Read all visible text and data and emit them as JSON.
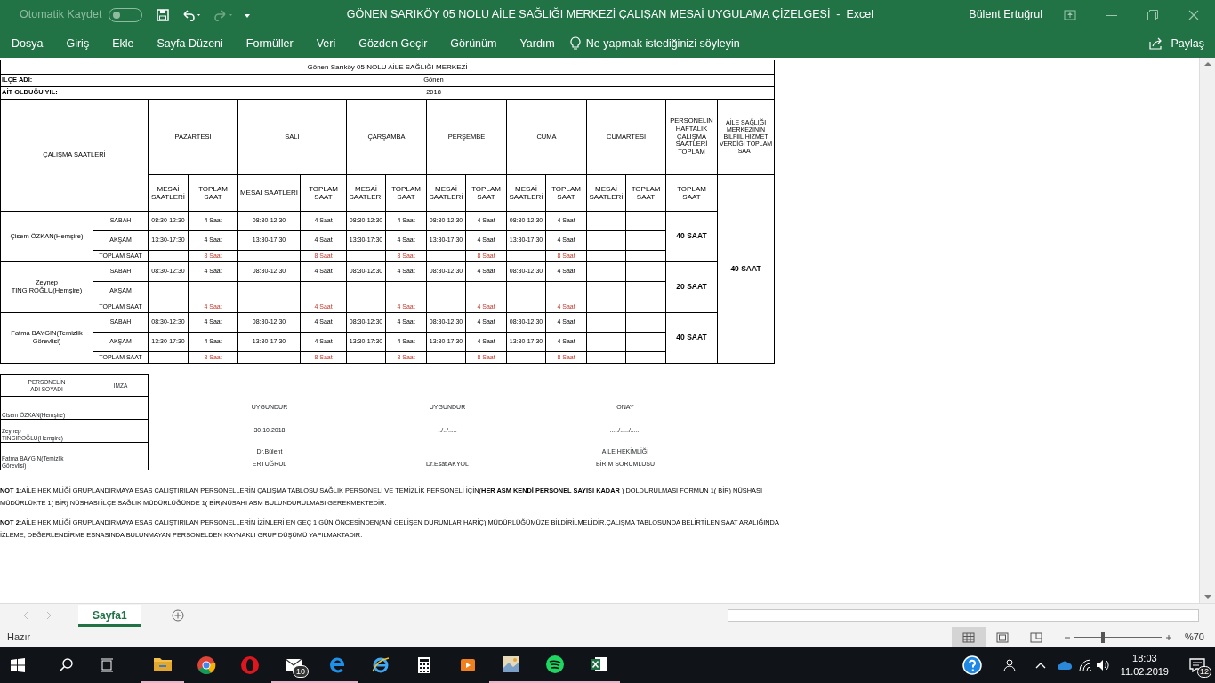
{
  "titlebar": {
    "autosave_label": "Otomatik Kaydet",
    "autosave_on": false,
    "title": "GÖNEN SARIKÖY 05 NOLU AİLE SAĞLIĞI MERKEZİ ÇALIŞAN MESAİ UYGULAMA ÇİZELGESİ  -  Excel",
    "user": "Bülent Ertuğrul"
  },
  "ribbon_tabs": [
    "Dosya",
    "Giriş",
    "Ekle",
    "Sayfa Düzeni",
    "Formüller",
    "Veri",
    "Gözden Geçir",
    "Görünüm",
    "Yardım"
  ],
  "tell_me": "Ne yapmak istediğinizi söyleyin",
  "share": "Paylaş",
  "sheet": {
    "title": "Gönen Sarıköy 05 NOLU AİLE SAĞLIĞI MERKEZİ",
    "district_label": "İLÇE ADI:",
    "district": "Gönen",
    "year_label": "AİT OLDUĞU YIL:",
    "year": "2018",
    "hours_header": "ÇALIŞMA SAATLERİ",
    "days": [
      {
        "name": "PAZARTESİ",
        "col_1": "MESAİ SAATLERİ",
        "col_2": "TOPLAM SAAT"
      },
      {
        "name": "SALI",
        "col_1": "MESAİ SAATLERİ",
        "col_2": "TOPLAM SAAT"
      },
      {
        "name": "ÇARŞAMBA",
        "col_1": "MESAİ SAATLERİ",
        "col_2": "TOPLAM SAAT"
      },
      {
        "name": "PERŞEMBE",
        "col_1": "MESAİ SAATLERİ",
        "col_2": "TOPLAM SAAT"
      },
      {
        "name": "CUMA",
        "col_1": "MESAİ SAATLERİ",
        "col_2": "TOPLAM SAAT"
      },
      {
        "name": "CUMARTESİ",
        "col_1": "MESAİ SAATLERİ",
        "col_2": "TOPLAM SAAT"
      }
    ],
    "weekly_header": "PERSONELİN HAFTALIK ÇALIŞMA SAATLERİ TOPLAM",
    "weekly_sub": "TOPLAM SAAT",
    "center_header": "AİLE SAĞLIĞI MERKEZİNİN BİLFİİL HİZMET VERDİĞİ TOPLAM SAAT",
    "center_total": "49 SAAT",
    "staff": [
      {
        "name": "Çisem ÖZKAN(Hemşire)",
        "weekly_total": "40 SAAT",
        "rows": [
          {
            "kind": "shift",
            "label": "SABAH",
            "cells": [
              "08:30-12:30",
              "4 Saat",
              "08:30-12:30",
              "4 Saat",
              "08:30-12:30",
              "4 Saat",
              "08:30-12:30",
              "4 Saat",
              "08:30-12:30",
              "4 Saat",
              null,
              null
            ]
          },
          {
            "kind": "shift",
            "label": "AKŞAM",
            "cells": [
              "13:30-17:30",
              "4 Saat",
              "13:30-17:30",
              "4 Saat",
              "13:30-17:30",
              "4 Saat",
              "13:30-17:30",
              "4 Saat",
              "13:30-17:30",
              "4 Saat",
              null,
              null
            ]
          },
          {
            "kind": "total",
            "label": "TOPLAM SAAT",
            "cells": [
              null,
              "8 Saat",
              null,
              "8 Saat",
              null,
              "8 Saat",
              null,
              "8 Saat",
              null,
              "8 Saat",
              null,
              null
            ]
          }
        ]
      },
      {
        "name": "Zeynep\nTINGIROĞLU(Hemşire)",
        "weekly_total": "20 SAAT",
        "rows": [
          {
            "kind": "shift",
            "label": "SABAH",
            "cells": [
              "08:30-12:30",
              "4 Saat",
              "08:30-12:30",
              "4 Saat",
              "08:30-12:30",
              "4 Saat",
              "08:30-12:30",
              "4 Saat",
              "08:30-12:30",
              "4 Saat",
              null,
              null
            ]
          },
          {
            "kind": "shift",
            "label": "AKŞAM",
            "cells": [
              null,
              null,
              null,
              null,
              null,
              null,
              null,
              null,
              null,
              null,
              null,
              null
            ]
          },
          {
            "kind": "total",
            "label": "TOPLAM SAAT",
            "cells": [
              null,
              "4 Saat",
              null,
              "4 Saat",
              null,
              "4 Saat",
              null,
              "4 Saat",
              null,
              "4 Saat",
              null,
              null
            ]
          }
        ]
      },
      {
        "name": "Fatma BAYGIN(Temizlik\nGörevlisi)",
        "weekly_total": "40 SAAT",
        "rows": [
          {
            "kind": "shift",
            "label": "SABAH",
            "cells": [
              "08:30-12:30",
              "4 Saat",
              "08:30-12:30",
              "4 Saat",
              "08:30-12:30",
              "4 Saat",
              "08:30-12:30",
              "4 Saat",
              "08:30-12:30",
              "4 Saat",
              null,
              null
            ]
          },
          {
            "kind": "shift",
            "label": "AKŞAM",
            "cells": [
              "13:30-17:30",
              "4 Saat",
              "13:30-17:30",
              "4 Saat",
              "13:30-17:30",
              "4 Saat",
              "13:30-17:30",
              "4 Saat",
              "13:30-17:30",
              "4 Saat",
              null,
              null
            ]
          },
          {
            "kind": "total",
            "label": "TOPLAM SAAT",
            "cells": [
              null,
              "8 Saat",
              null,
              "8 Saat",
              null,
              "8 Saat",
              null,
              "8 Saat",
              null,
              "8 Saat",
              null,
              null
            ]
          }
        ]
      }
    ]
  },
  "signature_table": {
    "name_header": "PERSONELİN\nADI SOYADI",
    "sign_header": "İMZA",
    "names": [
      "Çisem ÖZKAN(Hemşire)",
      "Zeynep\nTINGIROĞLU(Hemşire)",
      "Fatma BAYGIN(Temizlik\nGörevlisi)"
    ]
  },
  "signers": [
    {
      "approval": "UYGUNDUR",
      "date": "30.10.2018",
      "name": "Dr.Bülent\nERTUĞRUL"
    },
    {
      "approval": "UYGUNDUR",
      "date": "../../.....",
      "name": "Dr.Esat AKYOL"
    },
    {
      "approval": "ONAY",
      "date": "...../...../......",
      "name": "AİLE HEKİMLİĞİ\nBİRİM SORUMLUSU"
    }
  ],
  "notes": [
    "**NOT 1:**AİLE HEKİMLİĞİ GRUPLANDIRMAYA ESAS ÇALIŞTIRILAN PERSONELLERİN ÇALIŞMA TABLOSU SAĞLIK PERSONELİ VE TEMİZLİK PERSONELİ İÇİN(**HER ASM KENDİ PERSONEL SAYISI KADAR** ) DOLDURULMASI FORMUN 1( BİR) NÜSHASI MÜDÜRLÜKTE 1( BİR) NÜSHASI İLÇE SAĞLIK MÜDÜRLÜĞÜNDE 1( BİR)NÜSAHI ASM BULUNDURULMASI GEREKMEKTEDİR.",
    "**NOT 2:**AİLE HEKİMLİĞİ GRUPLANDIRMAYA ESAS ÇALIŞTIRILAN PERSONELLERİN İZİNLERİ EN GEÇ 1 GÜN ÖNCESİNDEN(ANİ GELİŞEN DURUMLAR HARİÇ) MÜDÜRLÜĞÜMÜZE BİLDİRİLMELİDİR.ÇALIŞMA TABLOSUNDA BELİRTİLEN SAAT ARALIĞINDA İZLEME, DEĞERLENDİRME ESNASINDA BULUNMAYAN PERSONELDEN KAYNAKLI GRUP DÜŞÜMÜ YAPILMAKTADIR."
  ],
  "sheet_tabs": [
    {
      "label": "Sayfa1",
      "selected": true
    }
  ],
  "status": "Hazır",
  "view_buttons": [
    {
      "kind": "normal",
      "selected": true
    },
    {
      "kind": "page_layout",
      "selected": false
    },
    {
      "kind": "page_break",
      "selected": false
    }
  ],
  "zoom": {
    "level": 0.32
  },
  "zoom_label": "%70",
  "taskbar": {
    "apps": [
      {
        "kind": "folder",
        "running": true
      },
      {
        "kind": "chrome",
        "running": false
      },
      {
        "kind": "opera",
        "running": false
      },
      {
        "kind": "mail",
        "running": true,
        "badge": "10"
      },
      {
        "kind": "edge",
        "running": true
      },
      {
        "kind": "ie",
        "running": false
      },
      {
        "kind": "calculator",
        "running": false
      },
      {
        "kind": "media",
        "running": false
      },
      {
        "kind": "photo",
        "running": true
      },
      {
        "kind": "spotify",
        "running": true
      },
      {
        "kind": "excel",
        "running": true
      }
    ],
    "time": "18:03",
    "date": "11.02.2019",
    "notifications": "12"
  }
}
